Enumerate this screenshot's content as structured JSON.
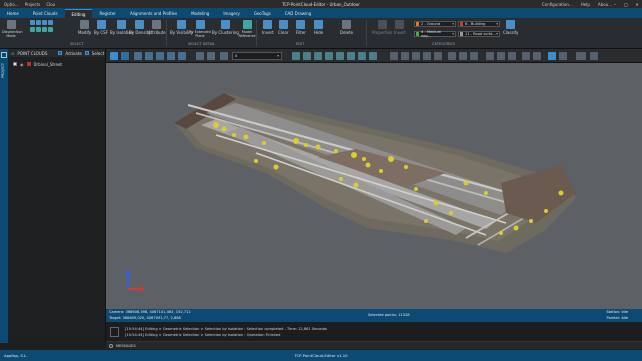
{
  "titlebar": {
    "quick_access": [
      "Optio...",
      "Projects",
      "Clou"
    ],
    "title": "TCP-PointCloud-Editor - Urban_Outdoor",
    "right_items": [
      "Configuration...",
      "Help",
      "Abou..."
    ]
  },
  "tabs": [
    "Home",
    "Point Clouds",
    "Editing",
    "Register",
    "Alignments and Profiles",
    "Modeling",
    "Imagery",
    "GeoTags",
    "CAD Drawing"
  ],
  "active_tab": "Editing",
  "ribbon": {
    "buttons": [
      {
        "label": "Disselection Mode",
        "group": "select"
      },
      {
        "label": "Modify",
        "group": "select"
      },
      {
        "label": "By CSF",
        "group": "select"
      },
      {
        "label": "By Isolation",
        "group": "select"
      },
      {
        "label": "By Density",
        "group": "select"
      },
      {
        "label": "Attribute",
        "group": "select"
      },
      {
        "label": "By Visibility",
        "group": "select-detail"
      },
      {
        "label": "By Extended Plane",
        "group": "select-detail"
      },
      {
        "label": "By Clustering",
        "group": "select-detail"
      },
      {
        "label": "Model Reference",
        "group": "select-detail"
      },
      {
        "label": "Invert",
        "group": "edit"
      },
      {
        "label": "Clear",
        "group": "edit"
      },
      {
        "label": "Filter",
        "group": "edit"
      },
      {
        "label": "Hide",
        "group": "edit"
      },
      {
        "label": "Delete",
        "group": "edit"
      },
      {
        "label": "Properties",
        "group": "categories"
      },
      {
        "label": "Invert",
        "group": "categories"
      },
      {
        "label": "Classify",
        "group": "categories"
      }
    ],
    "group_labels": {
      "select": "SELECT",
      "select_detail": "SELECT DETAIL",
      "edit": "EDIT",
      "categories": "CATEGORIES"
    },
    "categories": [
      {
        "label": "2 - Ground",
        "color": "#e07a1f"
      },
      {
        "label": "6 - Building",
        "color": "#d03a2c"
      },
      {
        "label": "4 - Medium veg...",
        "color": "#3fae45"
      },
      {
        "label": "11 - Road surfa...",
        "color": "#9b9b9b"
      }
    ]
  },
  "side_strip": {
    "label": "PROJECT"
  },
  "left_panel": {
    "header": "POINT CLOUDS",
    "activate": "Activate",
    "select": "Select",
    "items": [
      {
        "name": "Ürbinol_Street"
      }
    ]
  },
  "view_toolbar": {
    "select_value": "0"
  },
  "status": {
    "camera": "Camera: 368608,398, 4067101,463, 152,712",
    "target": "Target: 368609,020, 4067091,77, 2,868",
    "selected": "Selected points: 11328",
    "station": "Station: Idle",
    "pointer": "Pointer: Idle"
  },
  "log": [
    "[10:54:44] Editing > Geometric Selection > Selection by Isolation : Selection completed - Time: 12,861 Seconds",
    "[10:54:44] Editing > Geometric Selection > Selection by Isolation : Operation Finished"
  ],
  "messages_label": "MESSAGES",
  "app_status": {
    "left": "Applisp, S.L.",
    "center": "TCP-PointCloud-Editor v1.10"
  }
}
